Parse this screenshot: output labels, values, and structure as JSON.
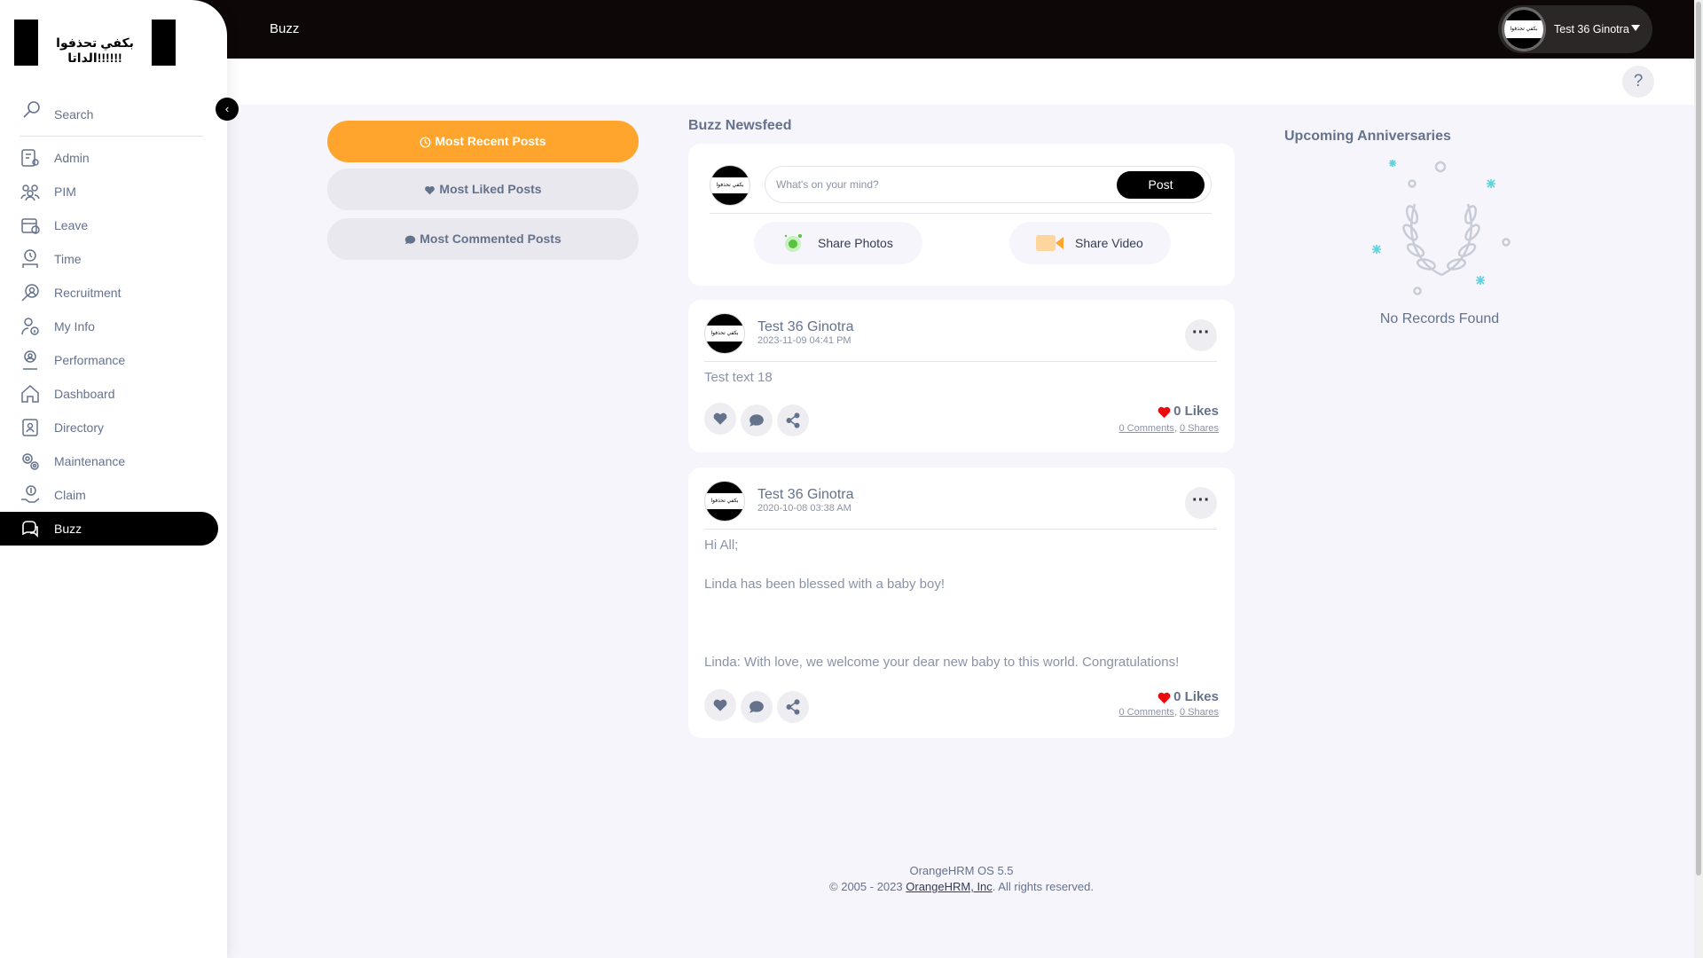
{
  "topbar": {
    "title": "Buzz",
    "user_name": "Test 36 Ginotra"
  },
  "logo_text": "بكفي تحذفوا الداتا!!!!!!",
  "help": {
    "label": "?"
  },
  "sidebar": {
    "search_label": "Search",
    "items": [
      {
        "label": "Admin",
        "icon": "admin-icon"
      },
      {
        "label": "PIM",
        "icon": "pim-icon"
      },
      {
        "label": "Leave",
        "icon": "leave-icon"
      },
      {
        "label": "Time",
        "icon": "time-icon"
      },
      {
        "label": "Recruitment",
        "icon": "recruitment-icon"
      },
      {
        "label": "My Info",
        "icon": "my-info-icon"
      },
      {
        "label": "Performance",
        "icon": "performance-icon"
      },
      {
        "label": "Dashboard",
        "icon": "dashboard-icon"
      },
      {
        "label": "Directory",
        "icon": "directory-icon"
      },
      {
        "label": "Maintenance",
        "icon": "maintenance-icon"
      },
      {
        "label": "Claim",
        "icon": "claim-icon"
      },
      {
        "label": "Buzz",
        "icon": "buzz-icon",
        "active": true
      }
    ]
  },
  "filters": [
    {
      "label": "Most Recent Posts",
      "icon": "clock-icon",
      "active": true
    },
    {
      "label": "Most Liked Posts",
      "icon": "heart-icon"
    },
    {
      "label": "Most Commented Posts",
      "icon": "comment-icon"
    }
  ],
  "newsfeed": {
    "title": "Buzz Newsfeed",
    "compose": {
      "placeholder": "What's on your mind?",
      "post_label": "Post",
      "share_photos_label": "Share Photos",
      "share_video_label": "Share Video"
    },
    "posts": [
      {
        "author": "Test 36 Ginotra",
        "date": "2023-11-09 04:41 PM",
        "lines": [
          "Test text 18"
        ],
        "likes": "0 Likes",
        "comments": "0 Comments",
        "shares": "0 Shares"
      },
      {
        "author": "Test 36 Ginotra",
        "date": "2020-10-08 03:38 AM",
        "lines": [
          "Hi All;",
          "Linda has been blessed with a baby boy!",
          "Linda: With love, we welcome your dear new baby to this world. Congratulations!"
        ],
        "likes": "0 Likes",
        "comments": "0 Comments",
        "shares": "0 Shares"
      }
    ]
  },
  "anniversaries": {
    "title": "Upcoming Anniversaries",
    "empty_text": "No Records Found"
  },
  "footer": {
    "version": "OrangeHRM OS 5.5",
    "copyright_prefix": "© 2005 - 2023",
    "company_link": "OrangeHRM, Inc",
    "copyright_suffix": ". All rights reserved."
  },
  "colors": {
    "accent": "#ffa52e",
    "topbar": "#0d0707",
    "active_nav": "#000000",
    "like_heart": "#eb0910"
  }
}
